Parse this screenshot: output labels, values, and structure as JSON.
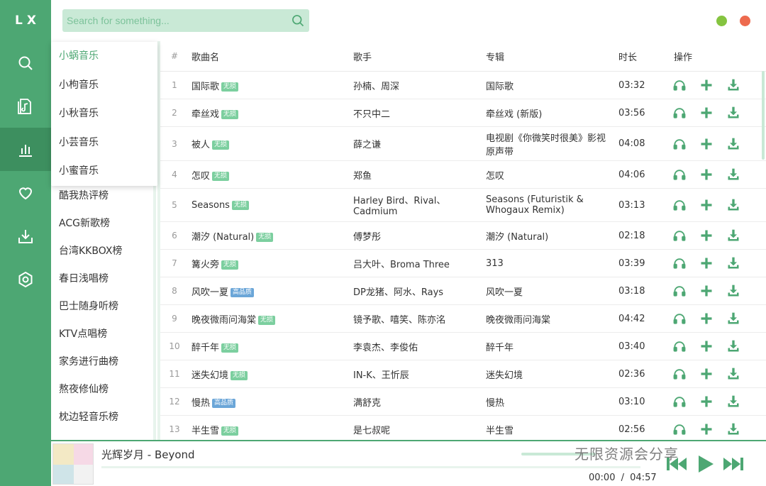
{
  "app": {
    "logo": "LX"
  },
  "nav": [
    {
      "icon": "search-icon",
      "name": "nav-search"
    },
    {
      "icon": "music-file-icon",
      "name": "nav-song-list"
    },
    {
      "icon": "chart-icon",
      "name": "nav-leaderboard",
      "active": true
    },
    {
      "icon": "heart-icon",
      "name": "nav-favorites"
    },
    {
      "icon": "download-icon",
      "name": "nav-download"
    },
    {
      "icon": "settings-icon",
      "name": "nav-settings"
    }
  ],
  "search": {
    "placeholder": "Search for something..."
  },
  "sources": [
    "小蜗音乐",
    "小枸音乐",
    "小秋音乐",
    "小芸音乐",
    "小蜜音乐"
  ],
  "boards": [
    "酷我热评榜",
    "ACG新歌榜",
    "台湾KKBOX榜",
    "春日浅唱榜",
    "巴士随身听榜",
    "KTV点唱榜",
    "家务进行曲榜",
    "熬夜修仙榜",
    "枕边轻音乐榜"
  ],
  "table": {
    "headers": {
      "num": "#",
      "name": "歌曲名",
      "singer": "歌手",
      "album": "专辑",
      "duration": "时长",
      "ops": "操作"
    },
    "rows": [
      {
        "num": "1",
        "name": "国际歌",
        "tag": "无损",
        "singer": "孙楠、周深",
        "album": "国际歌",
        "duration": "03:32"
      },
      {
        "num": "2",
        "name": "牵丝戏",
        "tag": "无损",
        "singer": "不只中二",
        "album": "牵丝戏 (新版)",
        "duration": "03:56"
      },
      {
        "num": "3",
        "name": "被人",
        "tag": "无损",
        "singer": "薛之谦",
        "album": "电视剧《你微笑时很美》影视原声带",
        "duration": "04:08"
      },
      {
        "num": "4",
        "name": "怎叹",
        "tag": "无损",
        "singer": "郑鱼",
        "album": "怎叹",
        "duration": "04:06"
      },
      {
        "num": "5",
        "name": "Seasons",
        "tag": "无损",
        "singer": "Harley Bird、Rival、Cadmium",
        "album": "Seasons (Futuristik & Whogaux Remix)",
        "duration": "03:13"
      },
      {
        "num": "6",
        "name": "潮汐 (Natural)",
        "tag": "无损",
        "singer": "傅梦彤",
        "album": "潮汐 (Natural)",
        "duration": "02:18"
      },
      {
        "num": "7",
        "name": "篝火旁",
        "tag": "无损",
        "singer": "吕大叶、Broma Three",
        "album": "313",
        "duration": "03:39"
      },
      {
        "num": "8",
        "name": "风吹一夏",
        "tag": "高品质",
        "singer": "DP龙猪、阿水、Rays",
        "album": "风吹一夏",
        "duration": "03:18"
      },
      {
        "num": "9",
        "name": "晚夜微雨问海棠",
        "tag": "无损",
        "singer": "镜予歌、嘻笑、陈亦洺",
        "album": "晚夜微雨问海棠",
        "duration": "04:42"
      },
      {
        "num": "10",
        "name": "醉千年",
        "tag": "无损",
        "singer": "李袁杰、李俊佑",
        "album": "醉千年",
        "duration": "03:40"
      },
      {
        "num": "11",
        "name": "迷失幻境",
        "tag": "无损",
        "singer": "IN-K、王忻辰",
        "album": "迷失幻境",
        "duration": "02:36"
      },
      {
        "num": "12",
        "name": "慢热",
        "tag": "高品质",
        "singer": "满舒克",
        "album": "慢热",
        "duration": "03:10"
      },
      {
        "num": "13",
        "name": "半生雪",
        "tag": "无损",
        "singer": "是七叔呢",
        "album": "半生雪",
        "duration": "02:56"
      }
    ]
  },
  "player": {
    "title": "光辉岁月 - Beyond",
    "current_time": "00:00",
    "separator": "/",
    "total_time": "04:57",
    "progress": 0,
    "watermark": "无限资源会分享"
  },
  "colors": {
    "accent": "#4da773",
    "accent_light": "#c9e9d6",
    "lossless_tag": "#7ccf9f",
    "hq_tag": "#6ba6d8"
  }
}
